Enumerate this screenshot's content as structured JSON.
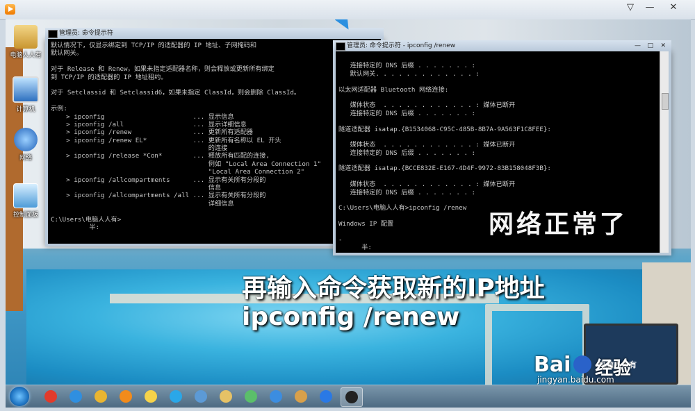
{
  "desktop_icons": [
    {
      "label": "电脑人人有",
      "color": "#d9b15a"
    },
    {
      "label": "计算机",
      "color": "#4a8ed8"
    },
    {
      "label": "网络",
      "color": "#3a7fd0"
    },
    {
      "label": "控制面板",
      "color": "#52a0d8"
    }
  ],
  "left_window": {
    "title": "管理员: 命令提示符",
    "lines": [
      "默认情况下，仅显示绑定到 TCP/IP 的适配器的 IP 地址、子网掩码和",
      "默认网关。",
      "",
      "对于 Release 和 Renew，如果未指定适配器名称，则会释放或更新所有绑定",
      "到 TCP/IP 的适配器的 IP 地址租约。",
      "",
      "对于 Setclassid 和 Setclassid6，如果未指定 ClassId，则会删除 ClassId。",
      "",
      "示例:",
      "    > ipconfig                       ... 显示信息",
      "    > ipconfig /all                  ... 显示详细信息",
      "    > ipconfig /renew                ... 更新所有适配器",
      "    > ipconfig /renew EL*            ... 更新所有名称以 EL 开头",
      "                                         的连接",
      "    > ipconfig /release *Con*        ... 释放所有匹配的连接,",
      "                                         例如 \"Local Area Connection 1\"",
      "                                         \"Local Area Connection 2\"",
      "    > ipconfig /allcompartments      ... 显示有关所有分段的",
      "                                         信息",
      "    > ipconfig /allcompartments /all ... 显示有关所有分段的",
      "                                         详细信息",
      "",
      "C:\\Users\\电脑人人有>",
      "          半:"
    ]
  },
  "right_window": {
    "title": "管理员: 命令提示符 - ipconfig  /renew",
    "lines": [
      "",
      "   连接特定的 DNS 后缀 . . . . . . . :",
      "   默认网关. . . . . . . . . . . . . :",
      "",
      "以太网适配器 Bluetooth 网络连接:",
      "",
      "   媒体状态  . . . . . . . . . . . . : 媒体已断开",
      "   连接特定的 DNS 后缀 . . . . . . . :",
      "",
      "隧道适配器 isatap.{B1534068-C95C-485B-8B7A-9A563F1C8FEE}:",
      "",
      "   媒体状态  . . . . . . . . . . . . : 媒体已断开",
      "   连接特定的 DNS 后缀 . . . . . . . :",
      "",
      "隧道适配器 isatap.{BCCE832E-E167-4D4F-9972-83B158048F3B}:",
      "",
      "   媒体状态  . . . . . . . . . . . . : 媒体已断开",
      "   连接特定的 DNS 后缀 . . . . . . . :",
      "",
      "C:\\Users\\电脑人人有>ipconfig /renew",
      "",
      "Windows IP 配置",
      "",
      "-",
      "      半:"
    ]
  },
  "overlay": {
    "status": "网络正常了",
    "instruction": "再输入命令获取新的IP地址",
    "command": "ipconfig /renew"
  },
  "watermark": {
    "brand": "Bai",
    "brand_cn": "经验",
    "url": "jingyan.baidu.com",
    "laptop_text": "电脑人人有"
  },
  "taskbar": {
    "apps": [
      {
        "name": "sogou-icon",
        "color": "#e23b2b"
      },
      {
        "name": "ie-icon",
        "color": "#2f8fe0"
      },
      {
        "name": "chrome-icon",
        "color": "#e9b531"
      },
      {
        "name": "media-icon",
        "color": "#f28b1b"
      },
      {
        "name": "notes-icon",
        "color": "#f6d34a"
      },
      {
        "name": "browser-icon",
        "color": "#2aa7e8"
      },
      {
        "name": "network-monitor-icon",
        "color": "#5c9ad6"
      },
      {
        "name": "explorer-icon",
        "color": "#e6c266"
      },
      {
        "name": "tool-icon",
        "color": "#5bbf6a"
      },
      {
        "name": "settings-icon",
        "color": "#3c8de0"
      },
      {
        "name": "paint-icon",
        "color": "#d8a04a"
      },
      {
        "name": "baidu-netdisk-icon",
        "color": "#2a79e5"
      },
      {
        "name": "cmd-icon",
        "color": "#222222"
      }
    ]
  }
}
